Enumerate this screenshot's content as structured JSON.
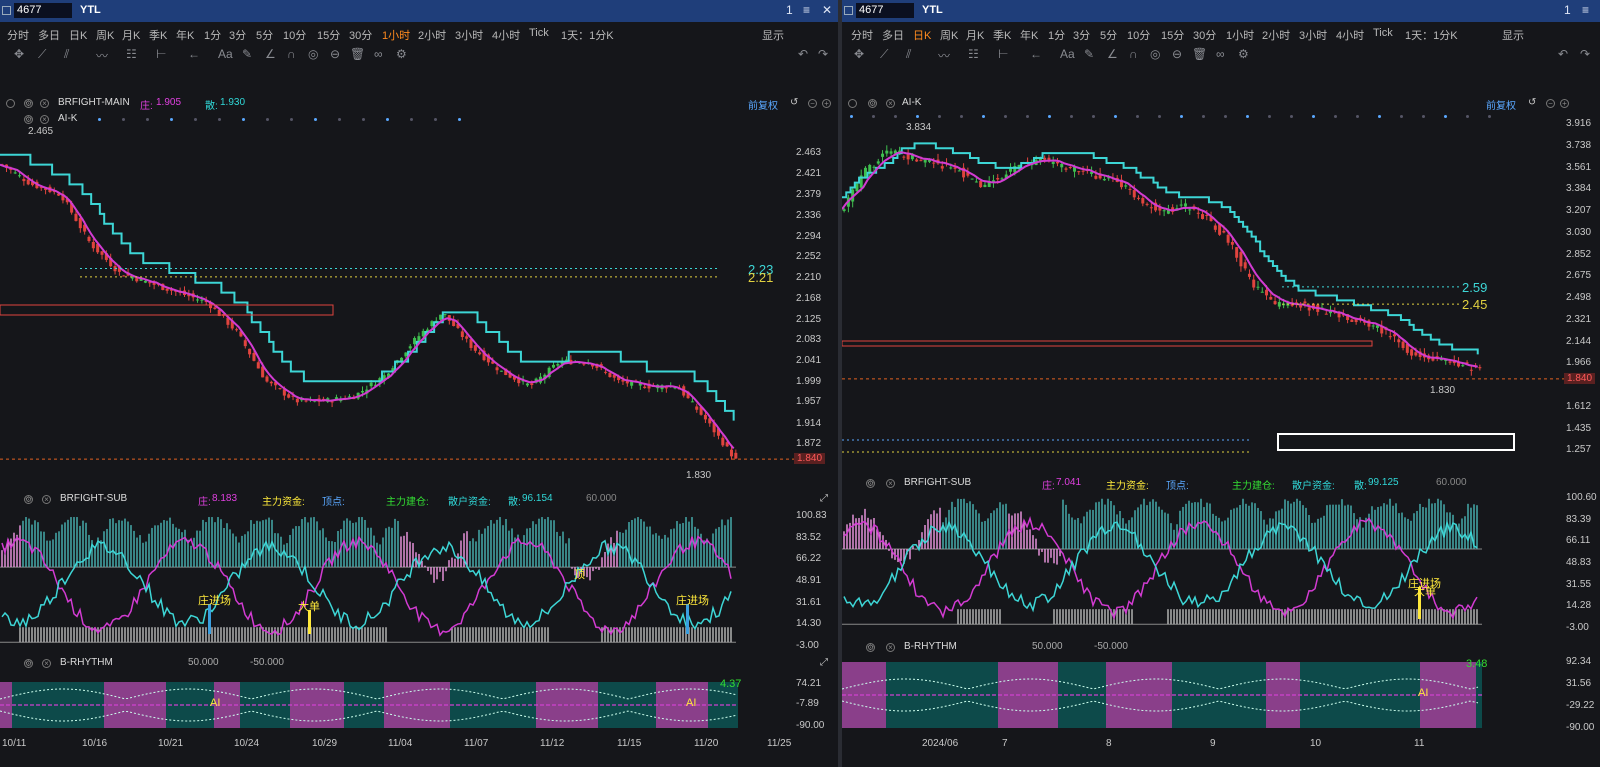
{
  "left": {
    "title_code": "4677",
    "title_name": "YTL",
    "window_buttons": [
      "1",
      "≡",
      "✕"
    ],
    "periods": [
      "分时",
      "多日",
      "日K",
      "周K",
      "月K",
      "季K",
      "年K",
      "1分",
      "3分",
      "5分",
      "10分",
      "15分",
      "30分",
      "1小时",
      "2小时",
      "3小时",
      "4小时",
      "Tick",
      "1天：1分K"
    ],
    "active_period": "1小时",
    "display_label": "显示",
    "main_indicator": {
      "name": "BRFIGHT-MAIN",
      "zhuang_label": "庄:",
      "zhuang_value": "1.905",
      "san_label": "散:",
      "san_value": "1.930",
      "fuquan": "前复权"
    },
    "sub_overlay_name": "AI-K",
    "peak_label": "2.465",
    "low_label": "1.830",
    "line_labels": [
      "2.23",
      "2.21"
    ],
    "price_axis": [
      "2.463",
      "2.421",
      "2.379",
      "2.336",
      "2.294",
      "2.252",
      "2.210",
      "2.168",
      "2.125",
      "2.083",
      "2.041",
      "1.999",
      "1.957",
      "1.914",
      "1.872"
    ],
    "current_price": "1.840",
    "sub": {
      "name": "BRFIGHT-SUB",
      "zhuang_label": "庄:",
      "zhuang_value": "8.183",
      "zhuli_label": "主力资金:",
      "dingdian_label": "顶点:",
      "zhuli_jieru": "主力建仓:",
      "sanhu_label": "散户资金:",
      "san_label": "散:",
      "san_value": "96.154",
      "level": "60.000"
    },
    "sub_axis": [
      "100.83",
      "83.52",
      "66.22",
      "48.91",
      "31.61",
      "14.30",
      "-3.00"
    ],
    "sub_annotations": [
      "庄进场",
      "大单",
      "庄进场",
      "顶"
    ],
    "rhythm": {
      "name": "B-RHYTHM",
      "up": "50.000",
      "down": "-50.000",
      "value": "4.37",
      "ai_label": "AI"
    },
    "rhythm_axis": [
      "74.21",
      "-7.89",
      "-90.00"
    ],
    "x_axis": [
      "10/11",
      "10/16",
      "10/21",
      "10/24",
      "10/29",
      "11/04",
      "11/07",
      "11/12",
      "11/15",
      "11/20",
      "11/25"
    ]
  },
  "right": {
    "title_code": "4677",
    "title_name": "YTL",
    "window_buttons": [
      "1",
      "≡"
    ],
    "periods": [
      "分时",
      "多日",
      "日K",
      "周K",
      "月K",
      "季K",
      "年K",
      "1分",
      "3分",
      "5分",
      "10分",
      "15分",
      "30分",
      "1小时",
      "2小时",
      "3小时",
      "4小时",
      "Tick",
      "1天：1分K"
    ],
    "active_period": "日K",
    "display_label": "显示",
    "main_indicator": {
      "name": "AI-K",
      "fuquan": "前复权"
    },
    "peak_label": "3.834",
    "low_label": "1.830",
    "line_labels": [
      "2.59",
      "2.45"
    ],
    "price_axis": [
      "3.916",
      "3.738",
      "3.561",
      "3.384",
      "3.207",
      "3.030",
      "2.852",
      "2.675",
      "2.498",
      "2.321",
      "2.144",
      "1.966",
      "1.612",
      "1.435",
      "1.257"
    ],
    "current_price": "1.840",
    "sub": {
      "name": "BRFIGHT-SUB",
      "zhuang_label": "庄:",
      "zhuang_value": "7.041",
      "zhuli_label": "主力资金:",
      "dingdian_label": "顶点:",
      "zhuli_jieru": "主力建仓:",
      "sanhu_label": "散户资金:",
      "san_label": "散:",
      "san_value": "99.125",
      "level": "60.000"
    },
    "sub_axis": [
      "100.60",
      "83.39",
      "66.11",
      "48.83",
      "31.55",
      "14.28",
      "-3.00"
    ],
    "sub_annotations": [
      "庄进场",
      "大单"
    ],
    "rhythm": {
      "name": "B-RHYTHM",
      "up": "50.000",
      "down": "-50.000",
      "value": "3.48",
      "ai_label": "AI"
    },
    "rhythm_axis": [
      "92.34",
      "31.56",
      "-29.22",
      "-90.00"
    ],
    "x_axis": [
      "2024/06",
      "7",
      "8",
      "9",
      "10",
      "11"
    ]
  },
  "colors": {
    "up": "#3fbf4f",
    "down": "#e0443e",
    "cyan": "#3dd6d6",
    "magenta": "#d23bd2",
    "bg": "#15161a",
    "titlebar": "#1f3e7a",
    "active": "#ff8a1e"
  }
}
